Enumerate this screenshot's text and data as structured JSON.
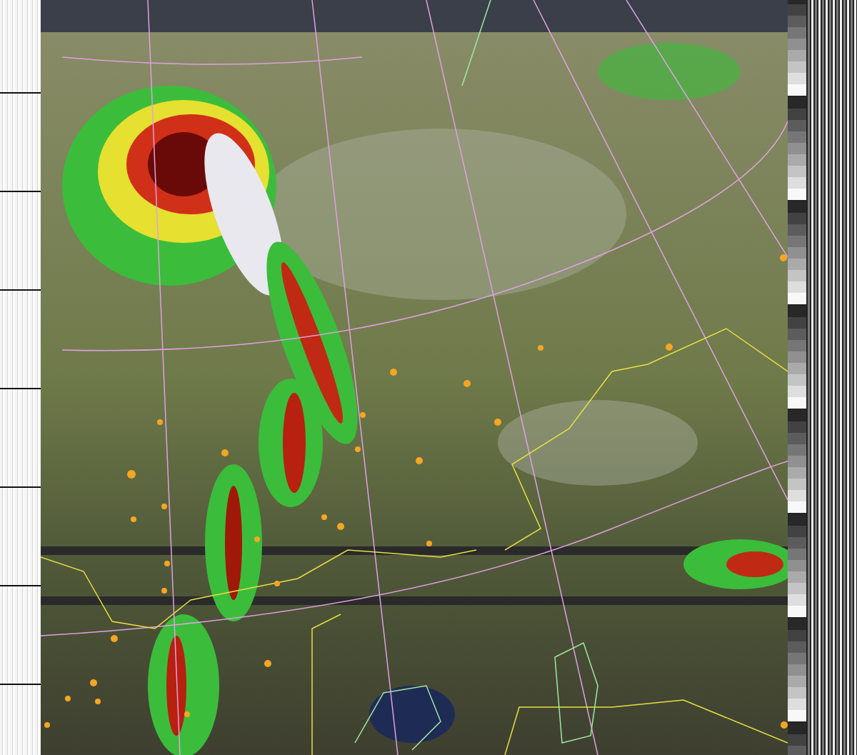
{
  "panels": [
    {
      "kind": "telemetry-strip"
    },
    {
      "kind": "satellite-image"
    },
    {
      "kind": "calibration-wedge"
    }
  ]
}
